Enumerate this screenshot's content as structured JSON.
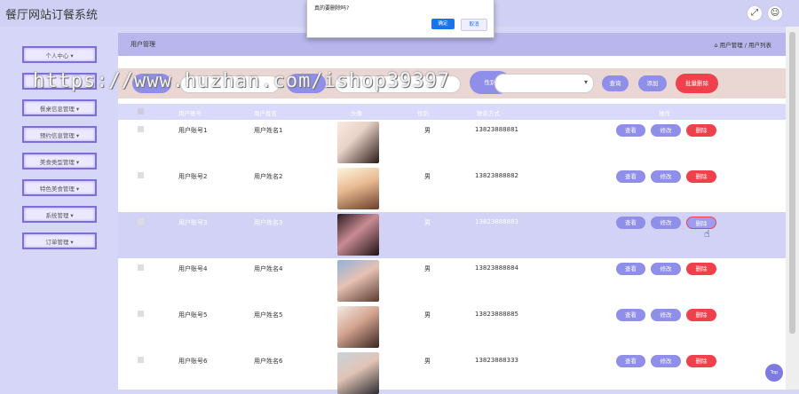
{
  "app": {
    "title": "餐厅网站订餐系统"
  },
  "topbar": {
    "expand_icon": "expand-icon",
    "user_icon": "user-icon"
  },
  "sidebar": {
    "items": [
      {
        "label": "个人中心 ▾"
      },
      {
        "label": ""
      },
      {
        "label": "餐桌信息管理 ▾"
      },
      {
        "label": "预约信息管理 ▾"
      },
      {
        "label": "美食类型管理 ▾"
      },
      {
        "label": "特色美食管理 ▾"
      },
      {
        "label": "系统管理 ▾"
      },
      {
        "label": "订单管理 ▾"
      }
    ]
  },
  "breadcrumb": {
    "title": "用户管理",
    "path": "用户管理 / 用户列表",
    "home_icon": "home-icon"
  },
  "search": {
    "gender_label": "性别",
    "gender_value": "",
    "query_label": "查询",
    "add_label": "添加",
    "batch_delete_label": "批量删除"
  },
  "table": {
    "headers": [
      "用户账号",
      "用户姓名",
      "头像",
      "性别",
      "联系方式",
      "操作"
    ],
    "view_label": "查看",
    "edit_label": "修改",
    "delete_label": "删除",
    "rows": [
      {
        "account": "用户账号1",
        "name": "用户姓名1",
        "gender": "男",
        "phone": "13823888881"
      },
      {
        "account": "用户账号2",
        "name": "用户姓名2",
        "gender": "男",
        "phone": "13823888882"
      },
      {
        "account": "用户账号3",
        "name": "用户姓名3",
        "gender": "男",
        "phone": "13823888883"
      },
      {
        "account": "用户账号4",
        "name": "用户姓名4",
        "gender": "男",
        "phone": "13823888884"
      },
      {
        "account": "用户账号5",
        "name": "用户姓名5",
        "gender": "男",
        "phone": "13823888885"
      },
      {
        "account": "用户账号6",
        "name": "用户姓名6",
        "gender": "男",
        "phone": "13823888333"
      }
    ]
  },
  "dialog": {
    "message": "真的要删除吗?",
    "ok_label": "确定",
    "cancel_label": "取消"
  },
  "watermark": {
    "text": "https://www.huzhan.com/ishop39397"
  },
  "back_to_top": {
    "label": "Top"
  },
  "colors": {
    "accent": "#8f8ee8",
    "danger": "#f0404c",
    "row_highlight": "#d2d2f7"
  }
}
